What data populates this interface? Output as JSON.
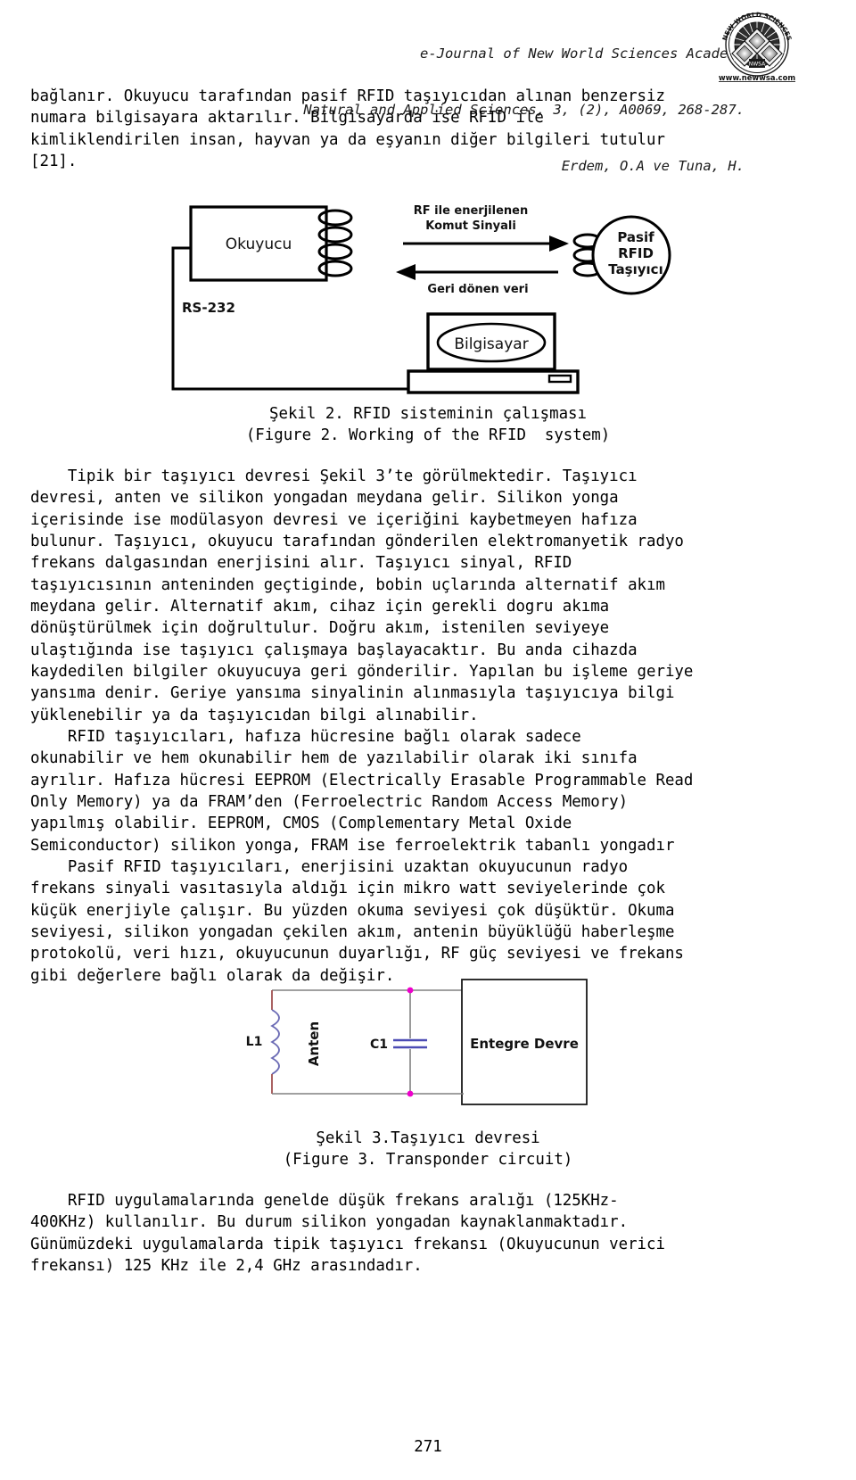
{
  "header": {
    "line1": "e-Journal of New World Sciences Academy",
    "line2": "Natural and Applied Sciences, 3, (2), A0069, 268-287.",
    "line3": "Erdem, O.A ve Tuna, H.",
    "seal": {
      "arc_top": "NEW WORLD SCIENCES",
      "center_label": "NWSA",
      "url": "www.newwsa.com"
    }
  },
  "body": {
    "paragraph1_lines": [
      "bağlanır. Okuyucu tarafından pasif RFID taşıyıcıdan alınan benzersiz",
      "numara bilgisayara aktarılır. Bilgisayarda ise RFID ile",
      "kimliklendirilen insan, hayvan ya da eşyanın diğer bilgileri tutulur",
      "[21]."
    ],
    "paragraph2_lines": [
      "    Tipik bir taşıyıcı devresi Şekil 3’te görülmektedir. Taşıyıcı",
      "devresi, anten ve silikon yongadan meydana gelir. Silikon yonga",
      "içerisinde ise modülasyon devresi ve içeriğini kaybetmeyen hafıza",
      "bulunur. Taşıyıcı, okuyucu tarafından gönderilen elektromanyetik radyo",
      "frekans dalgasından enerjisini alır. Taşıyıcı sinyal, RFID",
      "taşıyıcısının anteninden geçtiginde, bobin uçlarında alternatif akım",
      "meydana gelir. Alternatif akım, cihaz için gerekli dogru akıma",
      "dönüştürülmek için doğrultulur. Doğru akım, istenilen seviyeye",
      "ulaştığında ise taşıyıcı çalışmaya başlayacaktır. Bu anda cihazda",
      "kaydedilen bilgiler okuyucuya geri gönderilir. Yapılan bu işleme geriye",
      "yansıma denir. Geriye yansıma sinyalinin alınmasıyla taşıyıcıya bilgi",
      "yüklenebilir ya da taşıyıcıdan bilgi alınabilir."
    ],
    "paragraph3_lines": [
      "    RFID taşıyıcıları, hafıza hücresine bağlı olarak sadece",
      "okunabilir ve hem okunabilir hem de yazılabilir olarak iki sınıfa",
      "ayrılır. Hafıza hücresi EEPROM (Electrically Erasable Programmable Read",
      "Only Memory) ya da FRAM’den (Ferroelectric Random Access Memory)",
      "yapılmış olabilir. EEPROM, CMOS (Complementary Metal Oxide",
      "Semiconductor) silikon yonga, FRAM ise ferroelektrik tabanlı yongadır"
    ],
    "paragraph4_lines": [
      "    Pasif RFID taşıyıcıları, enerjisini uzaktan okuyucunun radyo",
      "frekans sinyali vasıtasıyla aldığı için mikro watt seviyelerinde çok",
      "küçük enerjiyle çalışır. Bu yüzden okuma seviyesi çok düşüktür. Okuma",
      "seviyesi, silikon yongadan çekilen akım, antenin büyüklüğü haberleşme",
      "protokolü, veri hızı, okuyucunun duyarlığı, RF güç seviyesi ve frekans",
      "gibi değerlere bağlı olarak da değişir."
    ],
    "paragraph5_lines": [
      "    RFID uygulamalarında genelde düşük frekans aralığı (125KHz-",
      "400KHz) kullanılır. Bu durum silikon yongadan kaynaklanmaktadır.",
      "Günümüzdeki uygulamalarda tipik taşıyıcı frekansı (Okuyucunun verici",
      "frekansı) 125 KHz ile 2,4 GHz arasındadır."
    ]
  },
  "figure1": {
    "reader_label": "Okuyucu",
    "forward_signal_line1": "RF ile enerjilenen",
    "forward_signal_line2": "Komut Sinyali",
    "return_signal": "Geri dönen veri",
    "tag_line1": "Pasif",
    "tag_line2": "RFID",
    "tag_line3": "Taşıyıcı",
    "serial_label": "RS-232",
    "computer_label": "Bilgisayar",
    "caption_tr": "Şekil 2. RFID sisteminin çalışması",
    "caption_en": "(Figure 2. Working of the RFID  system)"
  },
  "figure2": {
    "inductor_label": "L1",
    "antenna_label": "Anten",
    "capacitor_label": "C1",
    "ic_label": "Entegre Devre",
    "caption_tr": "Şekil 3.Taşıyıcı devresi",
    "caption_en": "(Figure 3. Transponder circuit)",
    "node_color": "#ee00cc",
    "wire_color": "#808080",
    "component_color": "#4b4bb4"
  },
  "footer": {
    "page_number": "271"
  }
}
